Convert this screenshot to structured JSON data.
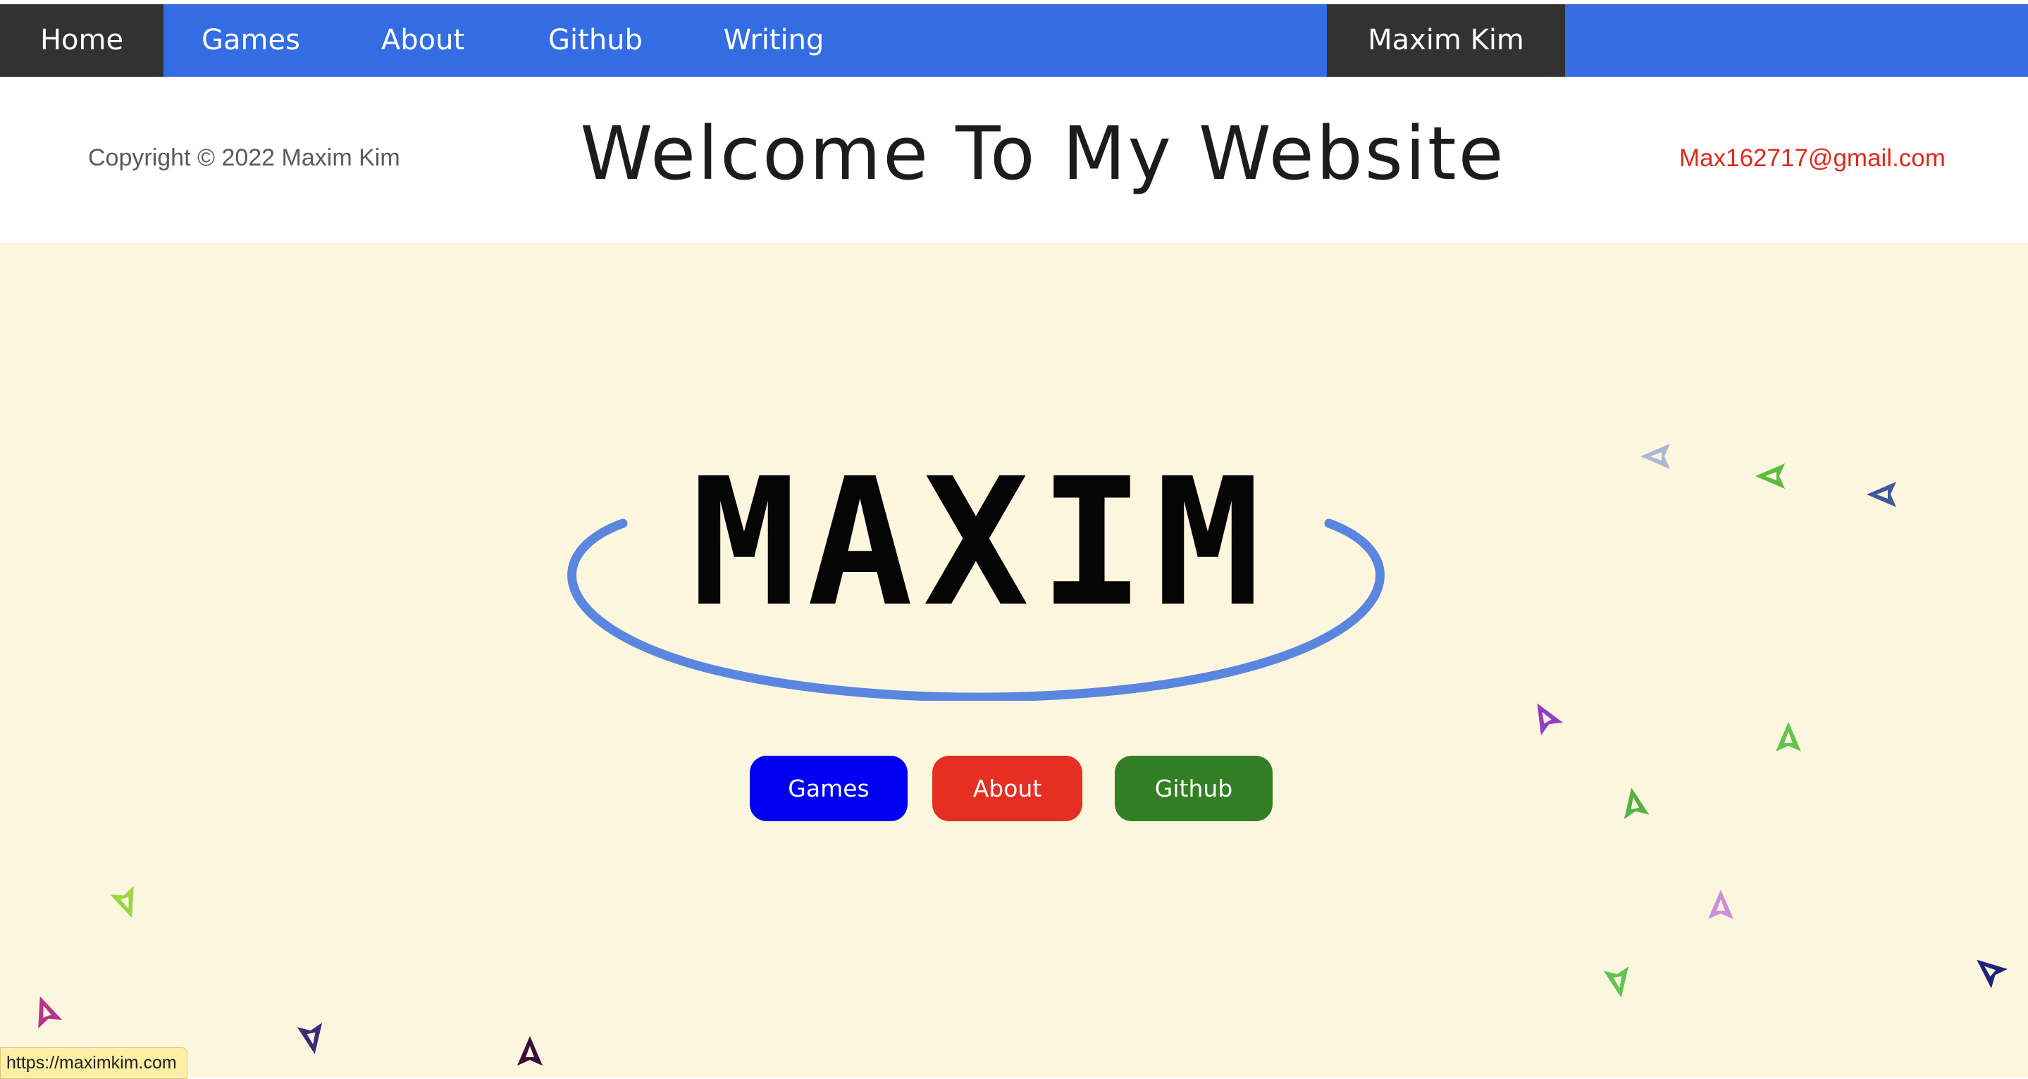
{
  "nav": {
    "home": "Home",
    "games": "Games",
    "about": "About",
    "github": "Github",
    "writing": "Writing",
    "name": "Maxim Kim"
  },
  "header": {
    "copyright": "Copyright © 2022 Maxim Kim",
    "title": "Welcome To My Website",
    "email": "Max162717@gmail.com"
  },
  "hero": {
    "logo_text": "MAXIM",
    "buttons": {
      "games": "Games",
      "about": "About",
      "github": "Github"
    }
  },
  "status_bar": {
    "url": "https://maximkim.com"
  },
  "colors": {
    "nav_blue": "#346de3",
    "nav_dark": "#323232",
    "hero_bg": "#fdf6df",
    "email_red": "#dd2a1b",
    "btn_games": "#0000f2",
    "btn_about": "#e42f22",
    "btn_github": "#338024",
    "logo_ring": "#5b86e0"
  },
  "decorations": {
    "icon": "arrow-ship-icon",
    "ship_colors": [
      "#a9b8d6",
      "#5cbd3d",
      "#3e5a9a",
      "#8e3fc4",
      "#64c24e",
      "#55b143",
      "#cd8fd8",
      "#62c451",
      "#1c2479",
      "#9ad641",
      "#b8338a",
      "#3a2b74",
      "#3c0f3a"
    ]
  }
}
